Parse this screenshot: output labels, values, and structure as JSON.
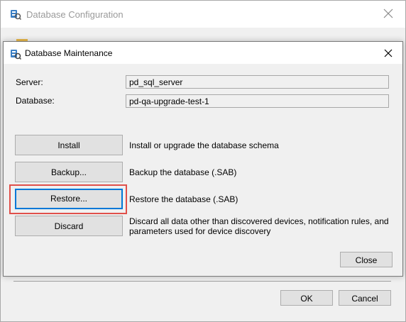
{
  "parent_dialog": {
    "title": "Database Configuration",
    "ok_label": "OK",
    "cancel_label": "Cancel"
  },
  "dialog": {
    "title": "Database Maintenance",
    "server_label": "Server:",
    "server_value": "pd_sql_server",
    "database_label": "Database:",
    "database_value": "pd-qa-upgrade-test-1",
    "actions": [
      {
        "button": "Install",
        "description": "Install or upgrade the database schema"
      },
      {
        "button": "Backup...",
        "description": "Backup the database (.SAB)"
      },
      {
        "button": "Restore...",
        "description": "Restore the database (.SAB)"
      },
      {
        "button": "Discard",
        "description": "Discard all data other than discovered devices, notification rules, and",
        "description_line2": "parameters used for device discovery"
      }
    ],
    "close_label": "Close"
  },
  "colors": {
    "highlight": "#e0504a",
    "focus": "#0078d7",
    "button_face": "#e1e1e1"
  }
}
